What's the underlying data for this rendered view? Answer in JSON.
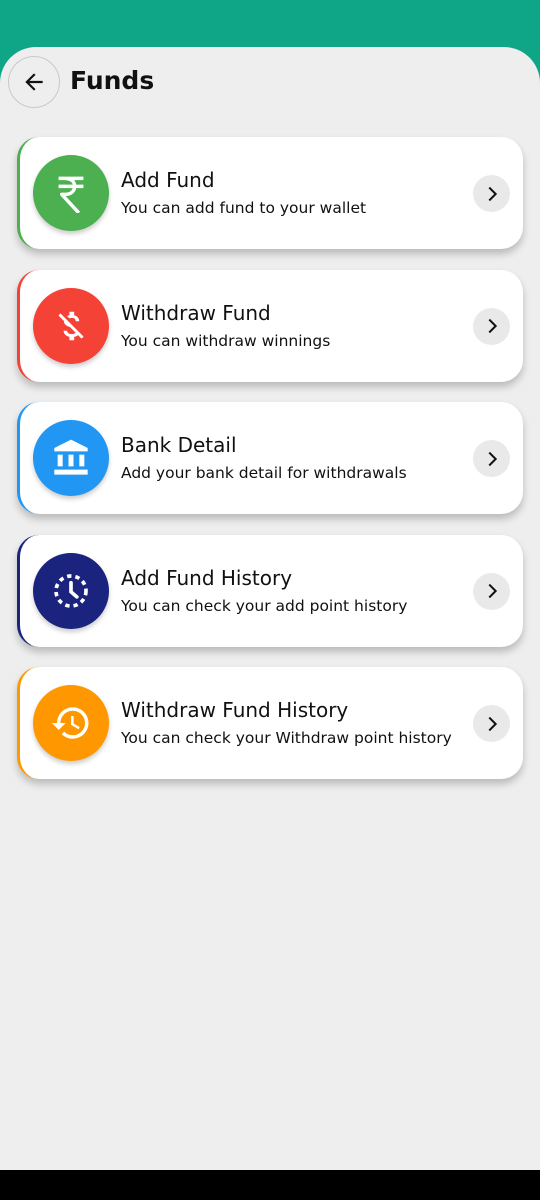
{
  "header": {
    "title": "Funds",
    "back_icon": "arrow-left-icon"
  },
  "items": [
    {
      "title": "Add Fund",
      "subtitle": "You can add fund to your wallet",
      "color": "#4caf50",
      "icon": "rupee-icon"
    },
    {
      "title": "Withdraw Fund",
      "subtitle": "You can withdraw winnings",
      "color": "#f44336",
      "icon": "money-off-icon"
    },
    {
      "title": "Bank Detail",
      "subtitle": "Add your bank detail for withdrawals",
      "color": "#2196f3",
      "icon": "bank-icon"
    },
    {
      "title": "Add Fund History",
      "subtitle": "You can check your add point history",
      "color": "#1a237e",
      "icon": "clock-dotted-icon"
    },
    {
      "title": "Withdraw Fund History",
      "subtitle": "You can check your Withdraw point history",
      "color": "#ff9800",
      "icon": "history-icon"
    }
  ],
  "colors": {
    "status_bar": "#0fa687",
    "background": "#eeeeee"
  }
}
